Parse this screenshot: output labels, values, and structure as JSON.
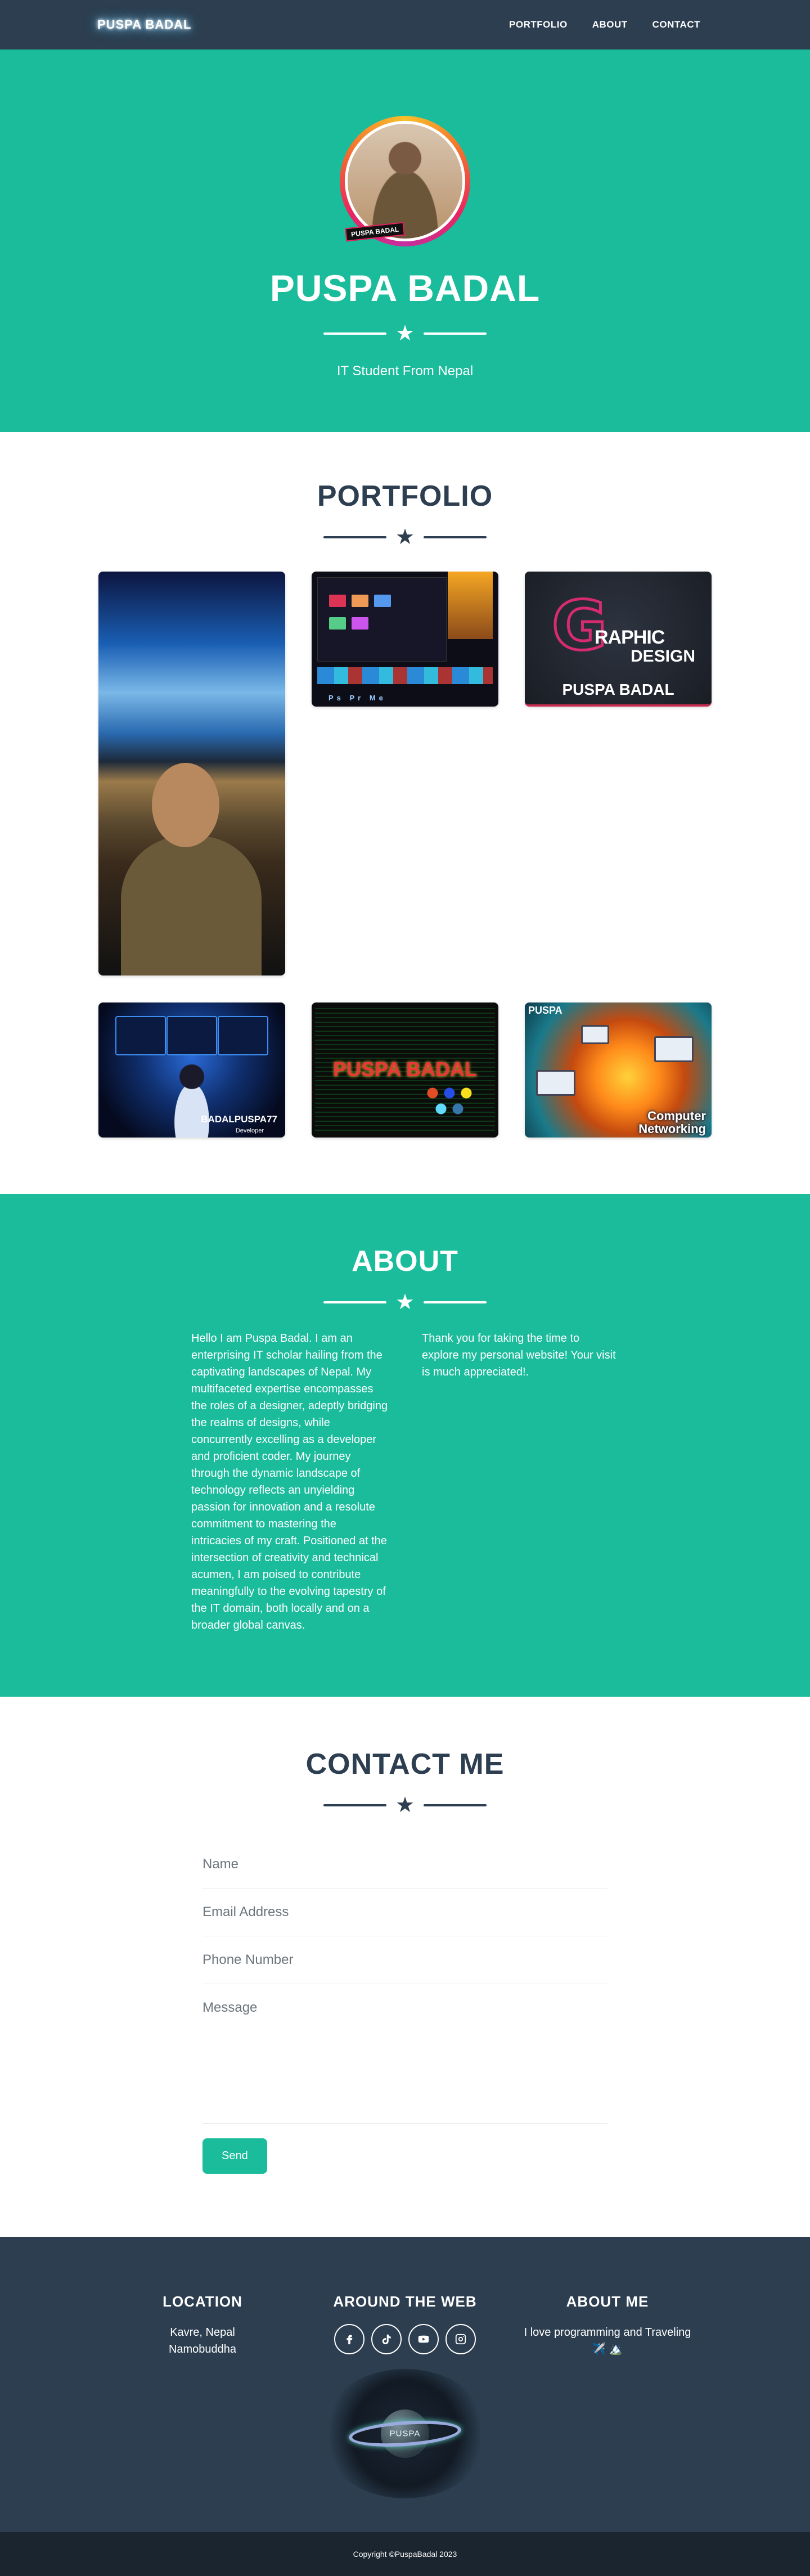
{
  "nav": {
    "brand": "PUSPA BADAL",
    "links": [
      "PORTFOLIO",
      "ABOUT",
      "CONTACT"
    ]
  },
  "hero": {
    "avatar_tag": "PUSPA BADAL",
    "name": "PUSPA BADAL",
    "subtitle": "IT Student From Nepal"
  },
  "portfolio": {
    "title": "PORTFOLIO",
    "items": [
      {
        "name": "workspace-photo"
      },
      {
        "name": "video-editing-screenshot",
        "apps": "Ps Pr Me"
      },
      {
        "name": "graphic-design",
        "g": "G",
        "line1": "RAPHIC",
        "line2": "DESIGN",
        "caption": "PUSPA BADAL"
      },
      {
        "name": "developer-setup",
        "title": "BADALPUSPA77",
        "subtitle": "Developer"
      },
      {
        "name": "coding-banner",
        "caption": "PUSPA BADAL"
      },
      {
        "name": "computer-networking",
        "tag": "PUSPA",
        "line1": "Computer",
        "line2": "Networking"
      }
    ]
  },
  "about": {
    "title": "ABOUT",
    "left": "Hello I am Puspa Badal. I am an enterprising IT scholar hailing from the captivating landscapes of Nepal. My multifaceted expertise encompasses the roles of a designer, adeptly bridging the realms of designs, while concurrently excelling as a developer and proficient coder. My journey through the dynamic landscape of technology reflects an unyielding passion for innovation and a resolute commitment to mastering the intricacies of my craft. Positioned at the intersection of creativity and technical acumen, I am poised to contribute meaningfully to the evolving tapestry of the IT domain, both locally and on a broader global canvas.",
    "right": "Thank you for taking the time to explore my personal website! Your visit is much appreciated!."
  },
  "contact": {
    "title": "CONTACT ME",
    "placeholders": {
      "name": "Name",
      "email": "Email Address",
      "phone": "Phone Number",
      "message": "Message"
    },
    "send": "Send"
  },
  "footer": {
    "location": {
      "title": "LOCATION",
      "line1": "Kavre, Nepal",
      "line2": "Namobuddha"
    },
    "web": {
      "title": "AROUND THE WEB",
      "icons": [
        "facebook-icon",
        "tiktok-icon",
        "youtube-icon",
        "instagram-icon"
      ]
    },
    "about": {
      "title": "ABOUT ME",
      "text": "I love programming and Traveling ✈️ 🏔️"
    },
    "planet_label": "PUSPA",
    "copyright": "Copyright ©PuspaBadal 2023"
  },
  "colors": {
    "primary": "#2c3e50",
    "accent": "#1abc9c",
    "footer_bottom": "#1a252f"
  }
}
